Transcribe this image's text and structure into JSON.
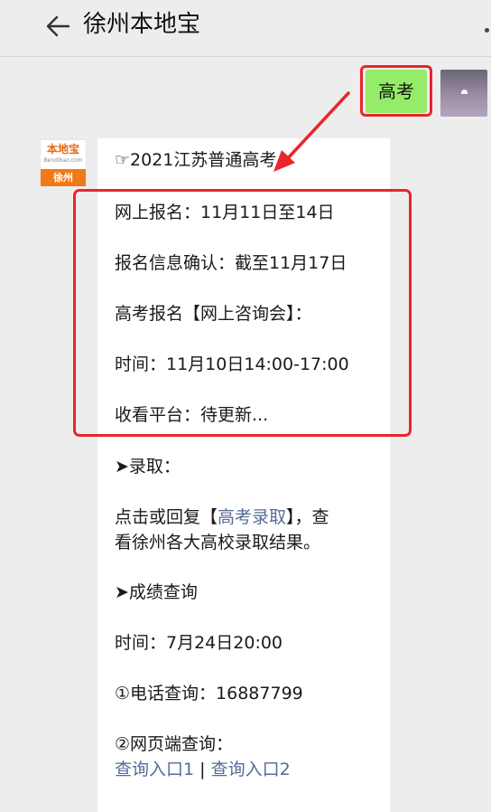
{
  "header": {
    "title": "徐州本地宝"
  },
  "outgoing": {
    "text": "高考"
  },
  "avatar": {
    "logo_text": "本地宝",
    "logo_sub": "Bendibao.com",
    "city": "徐州"
  },
  "message": {
    "heading": "☞2021江苏普通高考",
    "register_online": "网上报名：11月11日至14日",
    "confirm_info": "报名信息确认：截至11月17日",
    "consult_title": "高考报名【网上咨询会】：",
    "consult_time": "时间：11月10日14:00-17:00",
    "watch_platform": "收看平台：待更新...",
    "admission_title": "➤录取：",
    "admission_text_prefix": "点击或回复【",
    "admission_link": "高考录取",
    "admission_text_suffix": "】，查",
    "admission_text_line2": "看徐州各大高校录取结果。",
    "score_title": "➤成绩查询",
    "score_time": "时间：7月24日20:00",
    "phone_query": "①电话查询：16887799",
    "web_query": "②网页端查询：",
    "query_link_1": "查询入口1",
    "query_separator": "|",
    "query_link_2": "查询入口2"
  },
  "colors": {
    "background": "#ededed",
    "bubble_green": "#95ec69",
    "highlight_red": "#e8262b",
    "link_blue": "#576b95",
    "brand_orange": "#f07a18"
  },
  "icons": {
    "back": "back-arrow-icon",
    "more": "more-dots-icon"
  }
}
